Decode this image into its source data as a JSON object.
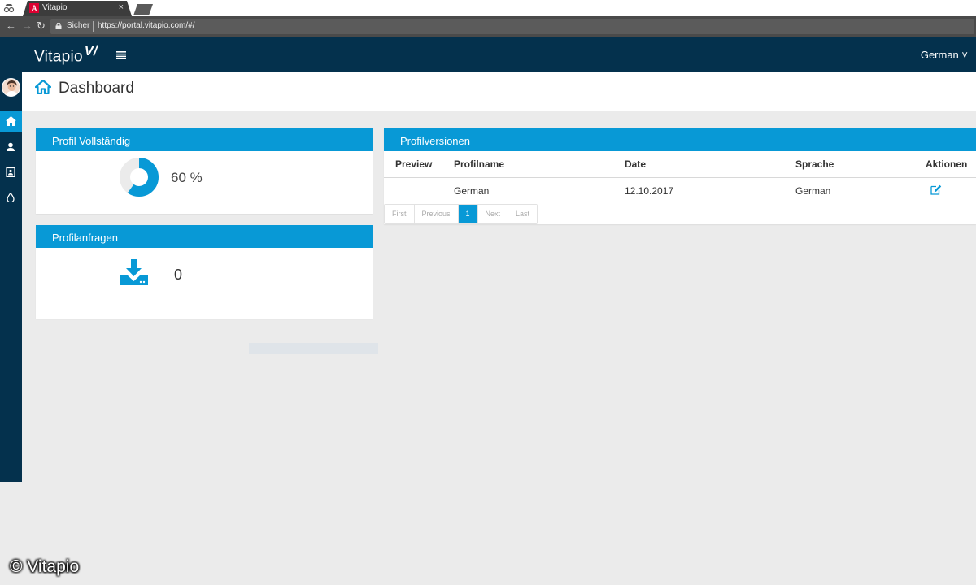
{
  "browser": {
    "tab_title": "Vitapio",
    "tab_favicon": "A",
    "tab_close": "×",
    "secure_label": "Sicher",
    "url": "https://portal.vitapio.com/#/"
  },
  "header": {
    "brand": "Vitapio",
    "brand_mark": "V/",
    "language": "German ˅"
  },
  "page": {
    "title": "Dashboard"
  },
  "profile_complete": {
    "title": "Profil Vollständig",
    "percent_label": "60 %",
    "percent_value": 0.6
  },
  "profile_requests": {
    "title": "Profilanfragen",
    "count": "0"
  },
  "profile_versions": {
    "title": "Profilversionen",
    "columns": [
      "Preview",
      "Profilname",
      "Date",
      "Sprache",
      "Aktionen"
    ],
    "rows": [
      {
        "preview": "",
        "name": "German",
        "date": "12.10.2017",
        "language": "German"
      }
    ],
    "pagination": [
      "First",
      "Previous",
      "1",
      "Next",
      "Last"
    ]
  },
  "watermark": "© Vitapio",
  "colors": {
    "navy": "#04314d",
    "accent": "#0899d6",
    "background": "#ebebeb"
  }
}
